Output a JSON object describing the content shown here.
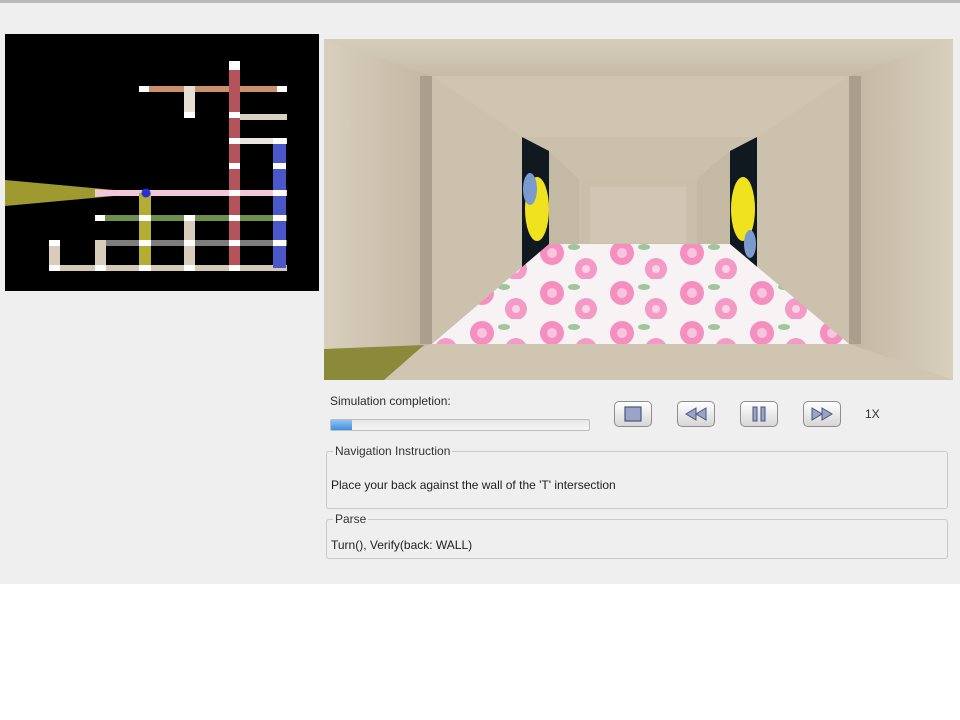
{
  "map": {
    "name": "overhead-maze-map"
  },
  "view": {
    "name": "first-person-hallway-view"
  },
  "controls": {
    "progress_label": "Simulation completion:",
    "progress_fraction": 0.08,
    "buttons": [
      {
        "name": "stop-button",
        "icon": "stop-icon"
      },
      {
        "name": "rewind-button",
        "icon": "rewind-icon"
      },
      {
        "name": "pause-button",
        "icon": "pause-icon"
      },
      {
        "name": "fast-forward-button",
        "icon": "fast-forward-icon"
      }
    ],
    "speed": "1X"
  },
  "navigation": {
    "title": "Navigation Instruction",
    "text": "Place your back against the wall of the 'T' intersection"
  },
  "parse": {
    "title": "Parse",
    "text": "Turn(), Verify(back: WALL)"
  },
  "colors": {
    "window_bg": "#efefef",
    "map_bg": "#000000",
    "progress_fill": "#3f8fdd",
    "wall": "#cbbfa9",
    "floor_pink": "#f3a5c8"
  }
}
